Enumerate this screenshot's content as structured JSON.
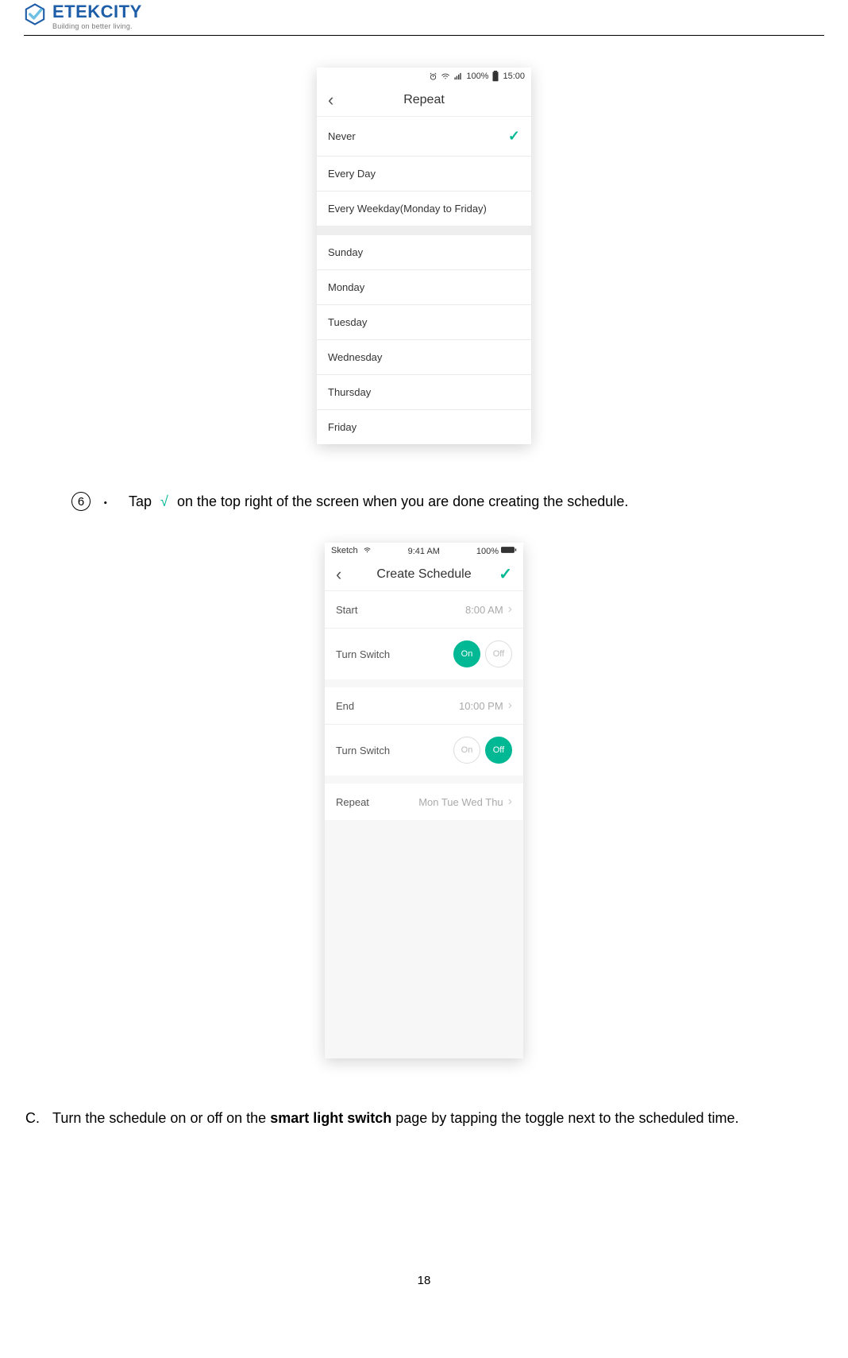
{
  "brand": {
    "name": "ETEKCITY",
    "tagline": "Building on better living."
  },
  "phone1": {
    "status": {
      "battery_pct": "100%",
      "time": "15:00"
    },
    "title": "Repeat",
    "group1": [
      {
        "label": "Never",
        "selected": true
      },
      {
        "label": "Every Day",
        "selected": false
      },
      {
        "label": "Every Weekday(Monday to Friday)",
        "selected": false
      }
    ],
    "group2": [
      {
        "label": "Sunday"
      },
      {
        "label": "Monday"
      },
      {
        "label": "Tuesday"
      },
      {
        "label": "Wednesday"
      },
      {
        "label": "Thursday"
      },
      {
        "label": "Friday"
      }
    ]
  },
  "step6": {
    "number": "6",
    "text_before": "Tap",
    "icon": "√",
    "text_after": "on the top right of the screen when you are done creating the schedule."
  },
  "phone2": {
    "status": {
      "carrier": "Sketch",
      "time": "9:41 AM",
      "battery_pct": "100%"
    },
    "title": "Create Schedule",
    "rows": {
      "start_label": "Start",
      "start_val": "8:00 AM",
      "switch1_label": "Turn Switch",
      "switch1_on": "On",
      "switch1_off": "Off",
      "end_label": "End",
      "end_val": "10:00 PM",
      "switch2_label": "Turn Switch",
      "switch2_on": "On",
      "switch2_off": "Off",
      "repeat_label": "Repeat",
      "repeat_val": "Mon Tue Wed Thu"
    }
  },
  "instruction_c": {
    "letter": "C.",
    "before": "Turn the schedule on or off on the ",
    "bold": "smart light switch",
    "after": " page by tapping the toggle next to the scheduled time."
  },
  "page_number": "18"
}
